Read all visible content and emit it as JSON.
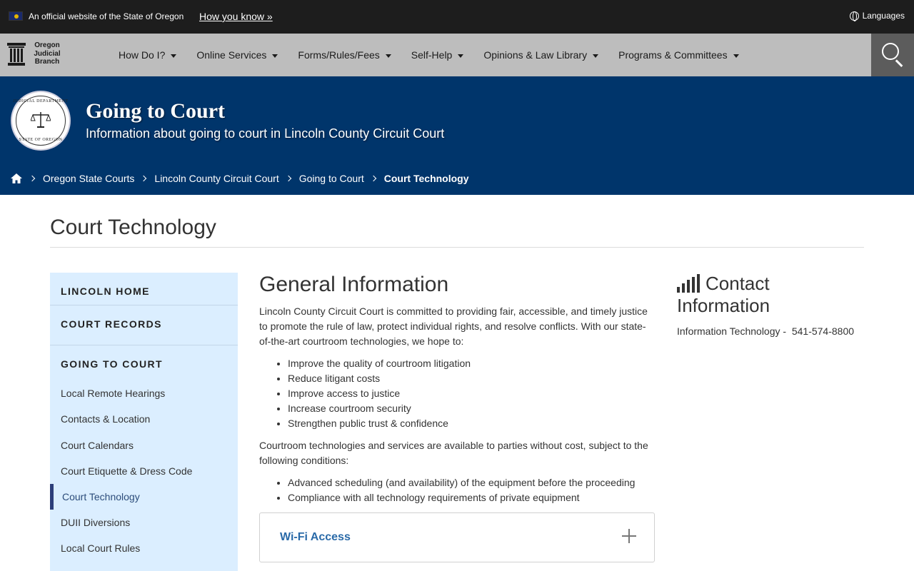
{
  "gov_banner": {
    "text": "An official website of the State of Oregon",
    "link": "How you know »",
    "languages": "Languages"
  },
  "nav": {
    "logo_lines": [
      "Oregon",
      "Judicial",
      "Branch"
    ],
    "items": [
      "How Do I?",
      "Online Services",
      "Forms/Rules/Fees",
      "Self-Help",
      "Opinions & Law Library",
      "Programs & Committees"
    ]
  },
  "hero": {
    "seal_top": "JUDICIAL DEPARTMENT",
    "seal_bottom": "STATE OF OREGON",
    "title": "Going to Court",
    "subtitle": "Information about going to court in Lincoln County Circuit Court"
  },
  "breadcrumb": {
    "items": [
      "Oregon State Courts",
      "Lincoln County Circuit Court",
      "Going to Court"
    ],
    "current": "Court Technology"
  },
  "page": {
    "title": "Court Technology"
  },
  "sidebar": {
    "headings": [
      "LINCOLN HOME",
      "COURT RECORDS",
      "GOING TO COURT"
    ],
    "items": [
      "Local Remote Hearings",
      "Contacts & Location",
      "Court Calendars",
      "Court Etiquette & Dress Code",
      "Court Technology",
      "DUII Diversions",
      "Local Court Rules"
    ]
  },
  "main": {
    "heading": "General Information",
    "intro": "Lincoln County Circuit Court is committed to providing fair, accessible, and timely justice to promote the rule of law, protect individual rights, and resolve conflicts. With our state-of-the-art courtroom technologies, we hope to:",
    "goals": [
      "Improve the quality of courtroom litigation",
      "Reduce litigant costs",
      "Improve access to justice",
      "Increase courtroom security",
      "Strengthen public trust & confidence"
    ],
    "conditions_intro": "Courtroom technologies and services are available to parties without cost, subject to the following conditions:",
    "conditions": [
      "Advanced scheduling (and availability) of the equipment before the proceeding",
      "Compliance with all technology requirements of private equipment"
    ],
    "accordion_title": "Wi-Fi Access"
  },
  "contact": {
    "title": "Contact Information",
    "line": "Information Technology -  541-574-8800"
  }
}
